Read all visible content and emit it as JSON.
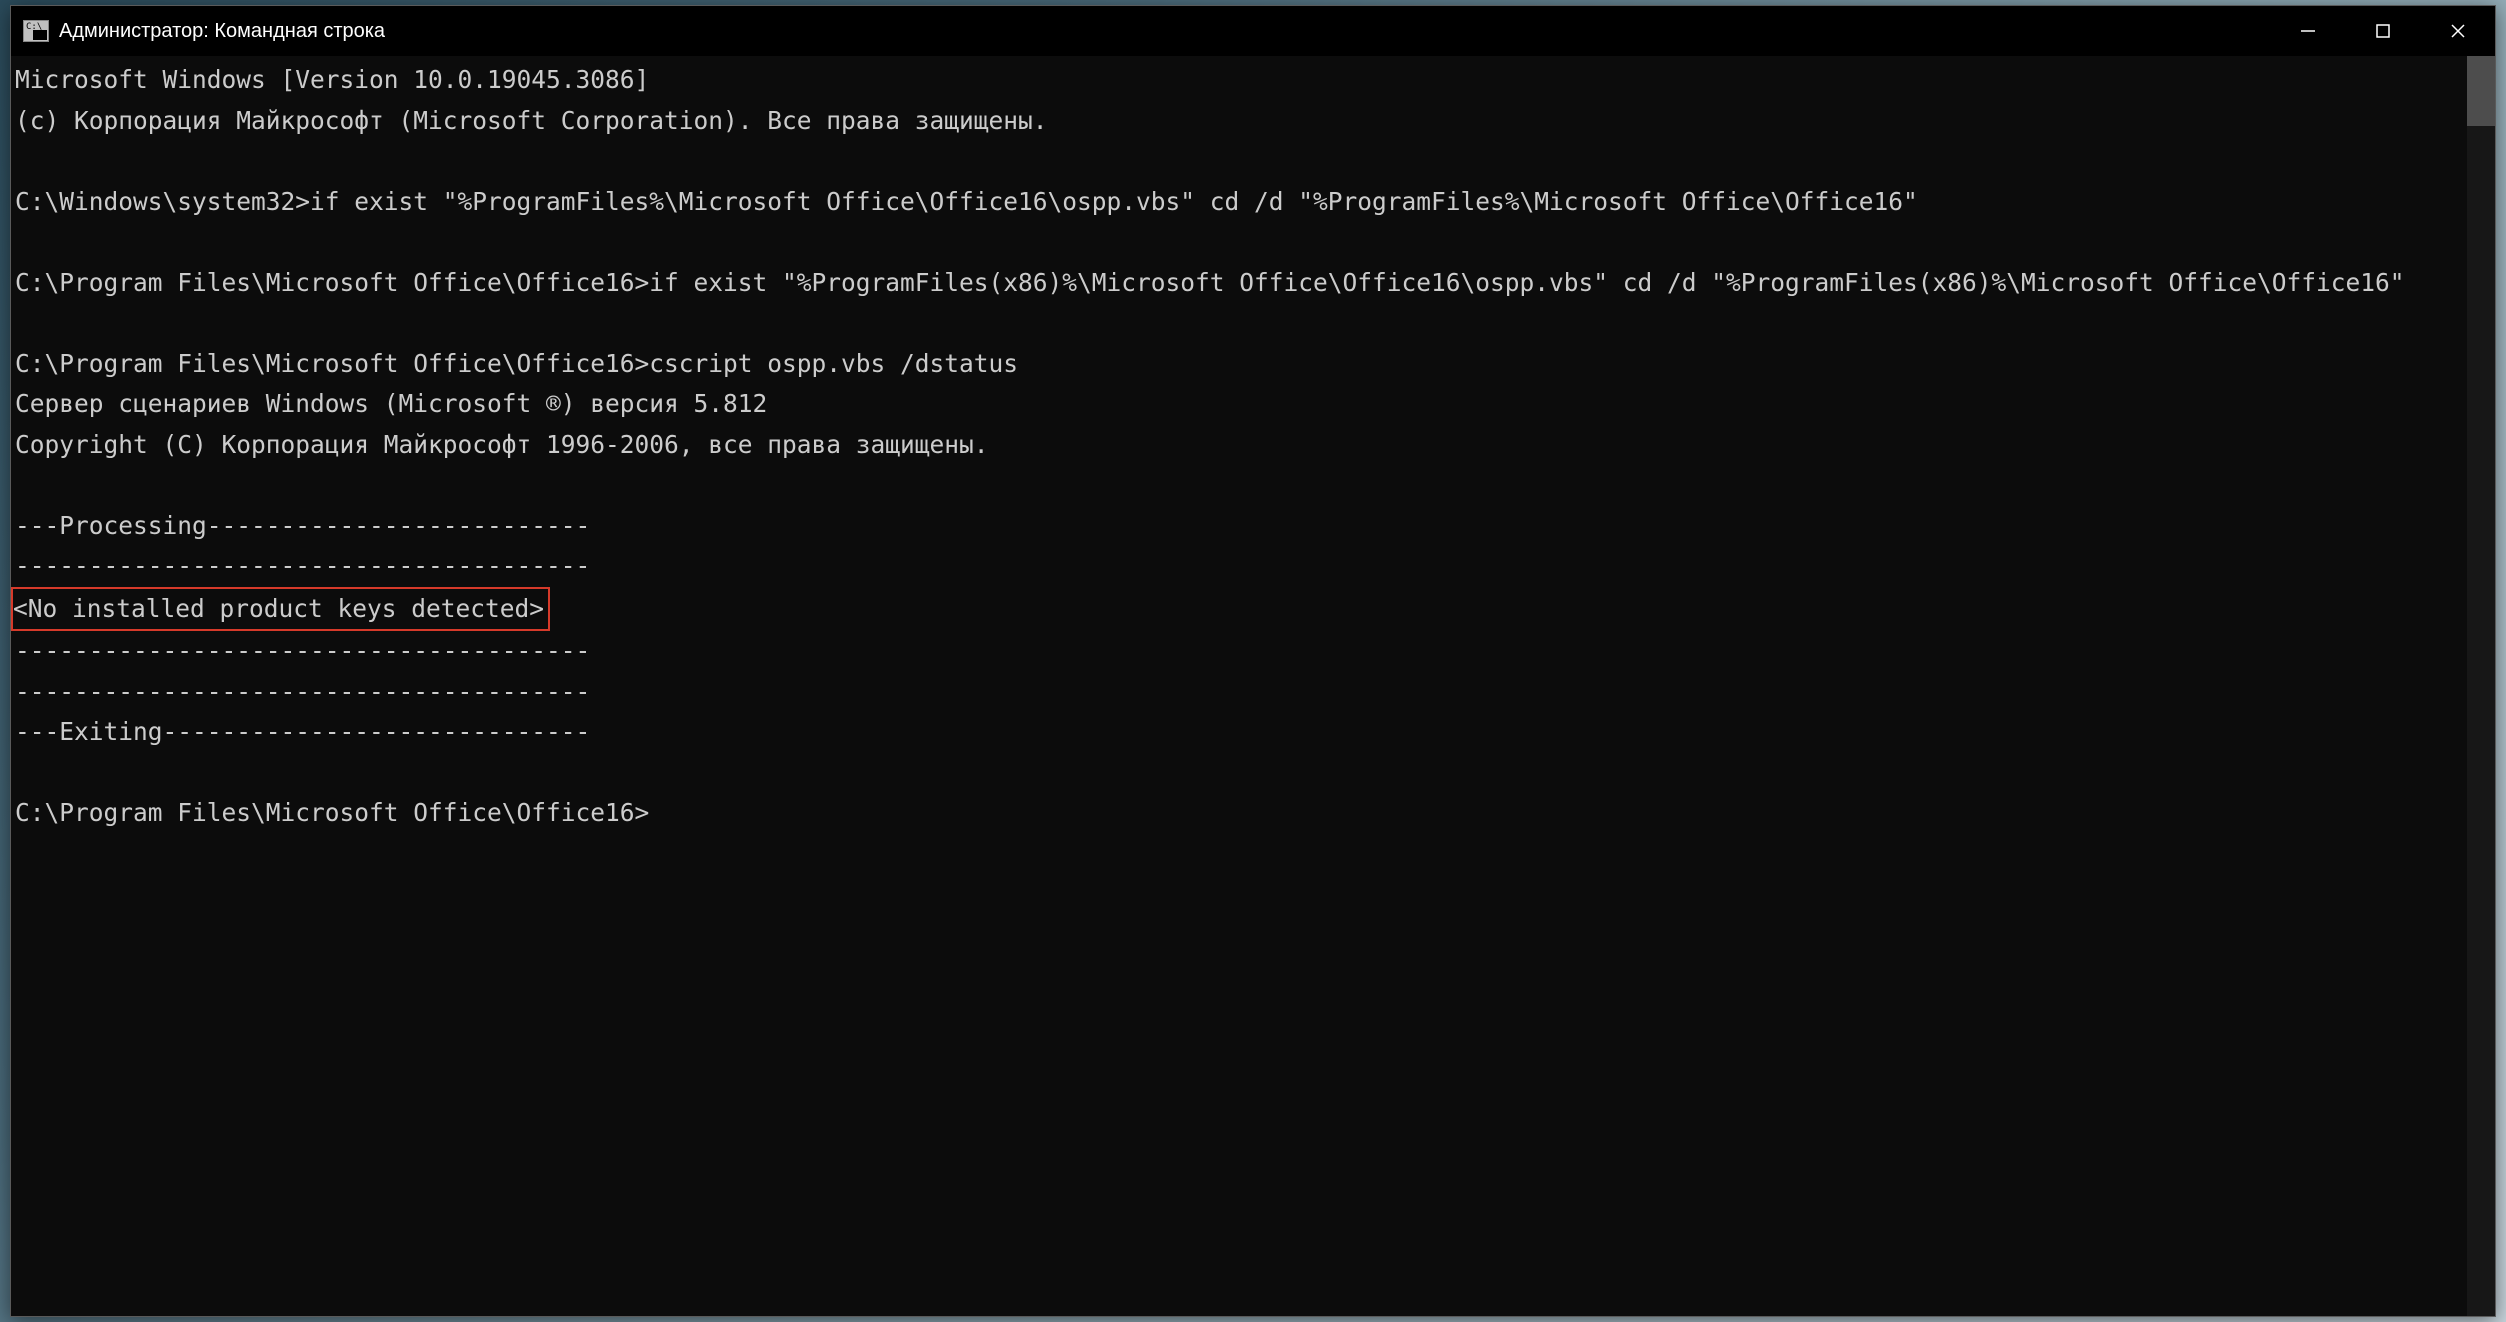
{
  "titlebar": {
    "title": "Администратор: Командная строка"
  },
  "terminal": {
    "lines": [
      "Microsoft Windows [Version 10.0.19045.3086]",
      "(c) Корпорация Майкрософт (Microsoft Corporation). Все права защищены.",
      "",
      "C:\\Windows\\system32>if exist \"%ProgramFiles%\\Microsoft Office\\Office16\\ospp.vbs\" cd /d \"%ProgramFiles%\\Microsoft Office\\Office16\"",
      "",
      "C:\\Program Files\\Microsoft Office\\Office16>if exist \"%ProgramFiles(x86)%\\Microsoft Office\\Office16\\ospp.vbs\" cd /d \"%ProgramFiles(x86)%\\Microsoft Office\\Office16\"",
      "",
      "C:\\Program Files\\Microsoft Office\\Office16>cscript ospp.vbs /dstatus",
      "Сервер сценариев Windows (Microsoft ®) версия 5.812",
      "Copyright (C) Корпорация Майкрософт 1996-2006, все права защищены.",
      "",
      "---Processing--------------------------",
      "---------------------------------------",
      "<No installed product keys detected>",
      "---------------------------------------",
      "---------------------------------------",
      "---Exiting-----------------------------",
      "",
      "C:\\Program Files\\Microsoft Office\\Office16>"
    ],
    "highlighted_line_index": 13
  }
}
